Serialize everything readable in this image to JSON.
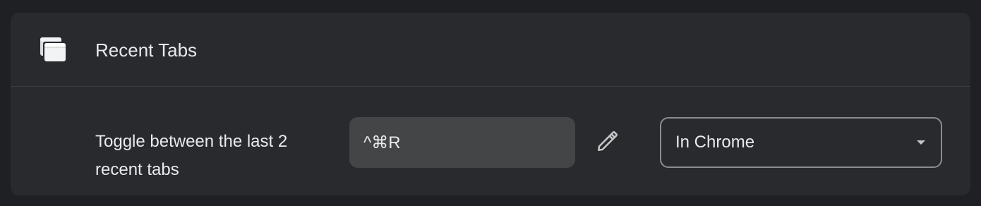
{
  "section": {
    "icon": "recent-tabs-icon",
    "title": "Recent Tabs"
  },
  "shortcut_row": {
    "description": "Toggle between the last 2 recent tabs",
    "shortcut_value": "^⌘R",
    "edit_icon": "pencil-icon",
    "scope_selected": "In Chrome",
    "scope_caret_icon": "caret-down-icon"
  },
  "colors": {
    "page_bg": "#1f2023",
    "card_bg": "#292a2d",
    "field_bg": "#444546",
    "text": "#e8eaed",
    "select_border": "#8a8c90"
  }
}
